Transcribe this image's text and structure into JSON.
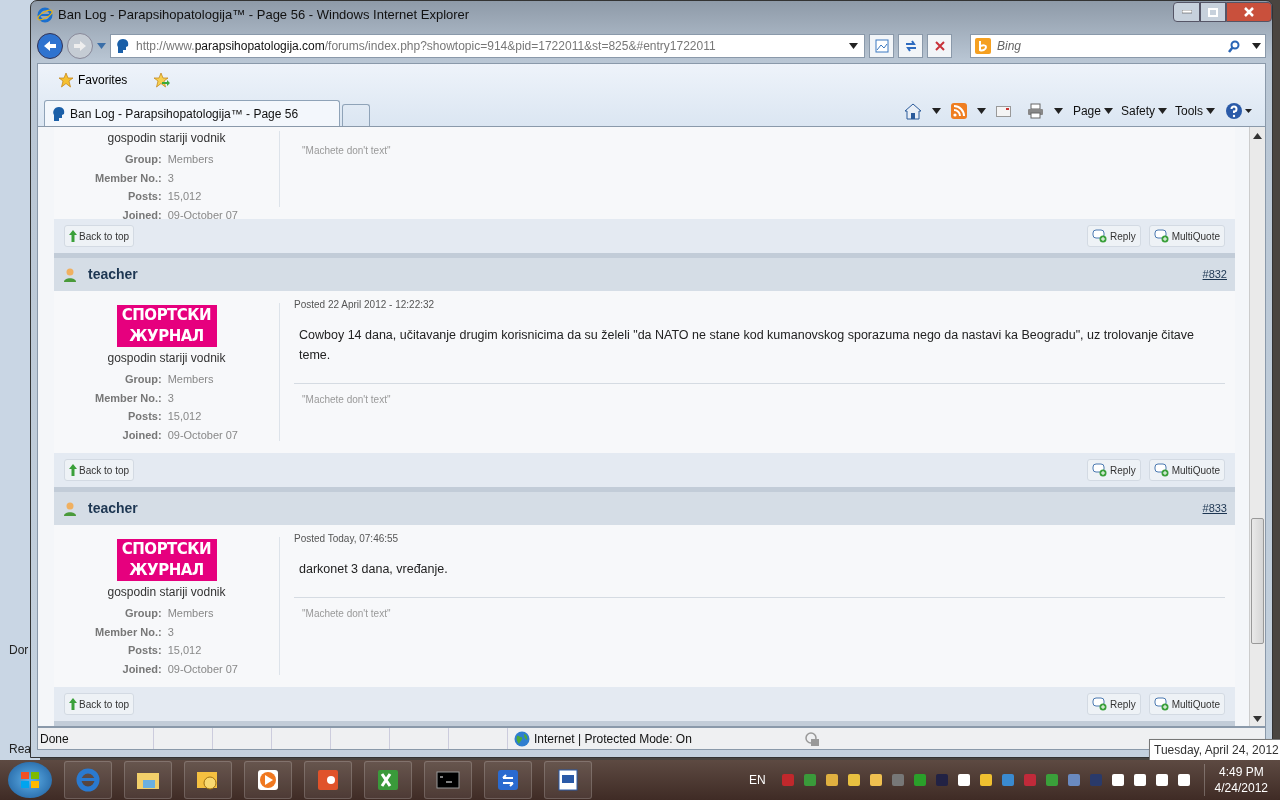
{
  "window": {
    "title": "Ban Log - Parapsihopatologija™ - Page 56 - Windows Internet Explorer"
  },
  "address_bar": {
    "url_prefix": "http://www.",
    "url_domain": "parapsihopatologija.com",
    "url_path": "/forums/index.php?showtopic=914&pid=1722011&st=825&#entry1722011"
  },
  "search": {
    "placeholder": "Bing"
  },
  "favorites_bar": {
    "label": "Favorites"
  },
  "tabs": [
    {
      "label": "Ban Log - Parapsihopatologija™ - Page 56",
      "selected": true
    }
  ],
  "command_bar": {
    "menus": [
      "Page",
      "Safety",
      "Tools"
    ]
  },
  "posts": [
    {
      "kind": "partial",
      "rank": "gospodin stariji vodnik",
      "profile": [
        {
          "label": "Group:",
          "value": "Members"
        },
        {
          "label": "Member No.:",
          "value": "3"
        },
        {
          "label": "Posts:",
          "value": "15,012"
        },
        {
          "label": "Joined:",
          "value": "09-October 07"
        }
      ],
      "signature": "\"Machete don't text\"",
      "buttons": {
        "back": "Back to top",
        "reply": "Reply",
        "multiquote": "MultiQuote"
      }
    },
    {
      "kind": "full",
      "author": "teacher",
      "number": "#832",
      "avatar_text": [
        "СПОРТСКИ",
        "ЖУРНАЛ"
      ],
      "posted": "Posted 22 April 2012 - 12:22:32",
      "body": "Cowboy 14 dana, učitavanje drugim korisnicima da su želeli \"da NATO ne stane kod kumanovskog sporazuma nego da nastavi ka Beogradu\", uz trolovanje čitave teme.",
      "rank": "gospodin stariji vodnik",
      "profile": [
        {
          "label": "Group:",
          "value": "Members"
        },
        {
          "label": "Member No.:",
          "value": "3"
        },
        {
          "label": "Posts:",
          "value": "15,012"
        },
        {
          "label": "Joined:",
          "value": "09-October 07"
        }
      ],
      "signature": "\"Machete don't text\"",
      "buttons": {
        "back": "Back to top",
        "reply": "Reply",
        "multiquote": "MultiQuote"
      }
    },
    {
      "kind": "full",
      "author": "teacher",
      "number": "#833",
      "avatar_text": [
        "СПОРТСКИ",
        "ЖУРНАЛ"
      ],
      "posted": "Posted Today, 07:46:55",
      "body": "darkonet 3 dana, vređanje.",
      "rank": "gospodin stariji vodnik",
      "profile": [
        {
          "label": "Group:",
          "value": "Members"
        },
        {
          "label": "Member No.:",
          "value": "3"
        },
        {
          "label": "Posts:",
          "value": "15,012"
        },
        {
          "label": "Joined:",
          "value": "09-October 07"
        }
      ],
      "signature": "\"Machete don't text\"",
      "buttons": {
        "back": "Back to top",
        "reply": "Reply",
        "multiquote": "MultiQuote"
      }
    }
  ],
  "status_bar": {
    "text": "Done",
    "zone": "Internet | Protected Mode: On"
  },
  "tooltip": "Tuesday, April 24, 2012",
  "background_window": {
    "texts": [
      "Dor",
      "Rea"
    ]
  },
  "taskbar": {
    "language": "EN",
    "time": "4:49 PM",
    "date": "4/24/2012"
  }
}
